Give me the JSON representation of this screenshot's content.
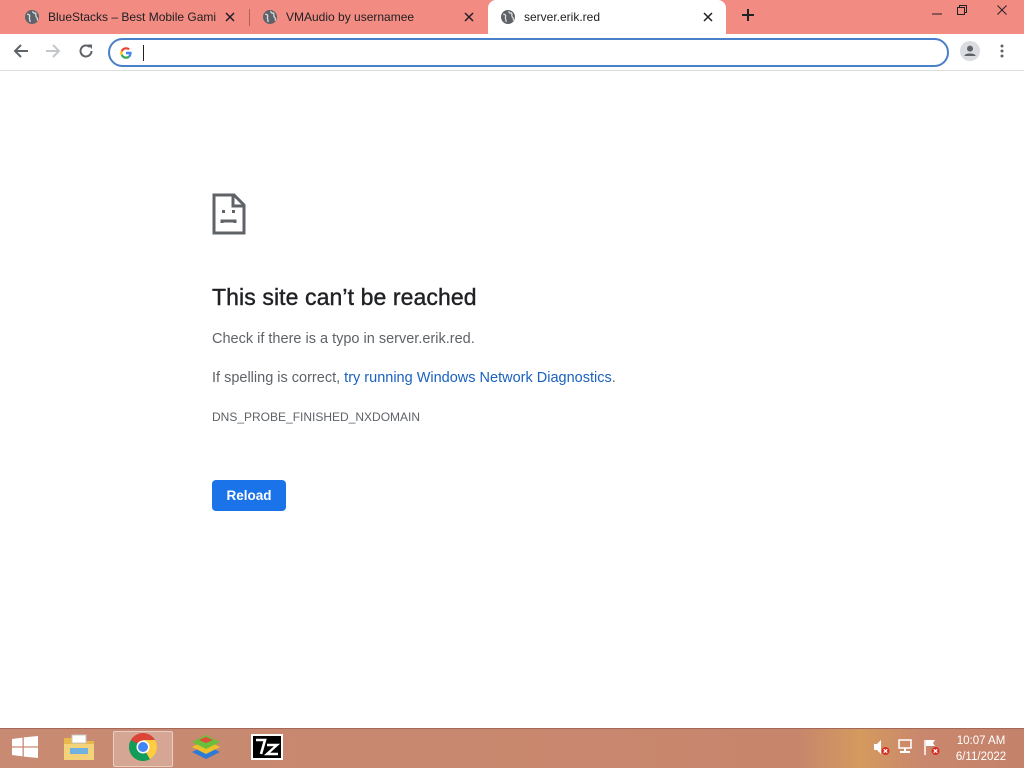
{
  "browser": {
    "tabs": [
      {
        "title": "BlueStacks – Best Mobile Gaming Platform",
        "favicon": "globe-icon",
        "active": false
      },
      {
        "title": "VMAudio by usernamee",
        "favicon": "globe-icon",
        "active": false
      },
      {
        "title": "server.erik.red",
        "favicon": "globe-icon",
        "active": true
      }
    ],
    "new_tab_icon": "plus-icon",
    "window_controls": [
      "minimize-icon",
      "restore-icon",
      "close-icon"
    ],
    "toolbar": {
      "back_icon": "arrow-left-icon",
      "forward_icon": "arrow-right-icon",
      "reload_icon": "reload-icon",
      "omnibox_value": "",
      "omnibox_icon": "google-g-icon",
      "profile_icon": "person-icon",
      "menu_icon": "kebab-menu-icon"
    }
  },
  "error_page": {
    "icon": "sad-document-icon",
    "heading": "This site can’t be reached",
    "typo_prefix": "Check if there is a typo in ",
    "host": "server.erik.red",
    "typo_suffix": ".",
    "spelling_prefix": "If spelling is correct, ",
    "diagnostics_link": "try running Windows Network Diagnostics",
    "spelling_suffix": ".",
    "error_code": "DNS_PROBE_FINISHED_NXDOMAIN",
    "reload_label": "Reload",
    "colors": {
      "link": "#1a61c0",
      "button": "#1a73e8",
      "text": "#5f6368",
      "heading": "#202124"
    }
  },
  "taskbar": {
    "start_icon": "windows-logo-icon",
    "pinned": [
      {
        "name": "file-explorer-icon",
        "active": false
      },
      {
        "name": "chrome-icon",
        "active": true
      },
      {
        "name": "bluestacks-icon",
        "active": false
      },
      {
        "name": "7zip-icon",
        "active": false
      }
    ],
    "tray": [
      "speaker-muted-icon",
      "network-icon",
      "action-center-flag-icon"
    ],
    "time": "10:07 AM",
    "date": "6/11/2022"
  },
  "colors": {
    "tabstrip": "#f28b82",
    "omnibox_border": "#4a80c8",
    "taskbar": "#c7866c"
  }
}
